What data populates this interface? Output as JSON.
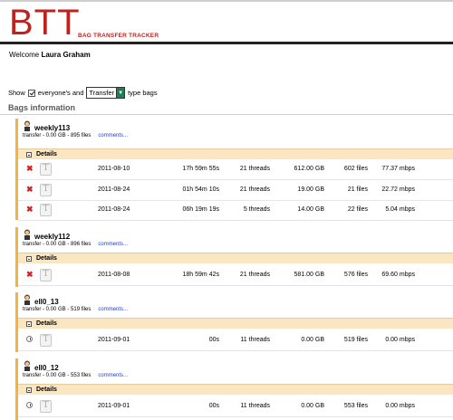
{
  "header": {
    "logo": "BTT",
    "subtitle": "BAG TRANSFER TRACKER",
    "welcome_prefix": "Welcome",
    "user_name": "Laura Graham"
  },
  "filter": {
    "show_label": "Show",
    "everyone_label": "everyone's and",
    "type_value": "Transfer",
    "suffix": "type bags"
  },
  "section_title": "Bags information",
  "bags": [
    {
      "name": "weekly113",
      "meta": "transfer - 0.00 GB - 895 files",
      "comments": "comments...",
      "details_label": "Details",
      "rows": [
        {
          "date": "2011-08-10",
          "duration": "17h 59m 55s",
          "threads": "21 threads",
          "size": "612.00 GB",
          "files": "602 files",
          "rate": "77.37 mbps"
        },
        {
          "date": "2011-08-24",
          "duration": "01h 54m 10s",
          "threads": "21 threads",
          "size": "19.00 GB",
          "files": "21 files",
          "rate": "22.72 mbps"
        },
        {
          "date": "2011-08-24",
          "duration": "06h 19m 19s",
          "threads": "5 threads",
          "size": "14.00 GB",
          "files": "22 files",
          "rate": "5.04 mbps"
        }
      ]
    },
    {
      "name": "weekly112",
      "meta": "transfer - 0.00 GB - 896 files",
      "comments": "comments...",
      "details_label": "Details",
      "rows": [
        {
          "date": "2011-08-08",
          "duration": "18h 59m 42s",
          "threads": "21 threads",
          "size": "581.00 GB",
          "files": "576 files",
          "rate": "69.60 mbps"
        }
      ]
    },
    {
      "name": "ell0_13",
      "meta": "transfer - 0.00 GB - 519 files",
      "comments": "comments...",
      "details_label": "Details",
      "rows": [
        {
          "date": "2011-09-01",
          "duration": "00s",
          "threads": "11 threads",
          "size": "0.00 GB",
          "files": "519 files",
          "rate": "0.00 mbps"
        }
      ]
    },
    {
      "name": "ell0_12",
      "meta": "transfer - 0.00 GB - 553 files",
      "comments": "comments...",
      "details_label": "Details",
      "rows": [
        {
          "date": "2011-09-01",
          "duration": "00s",
          "threads": "11 threads",
          "size": "0.00 GB",
          "files": "553 files",
          "rate": "0.00 mbps"
        }
      ]
    }
  ]
}
